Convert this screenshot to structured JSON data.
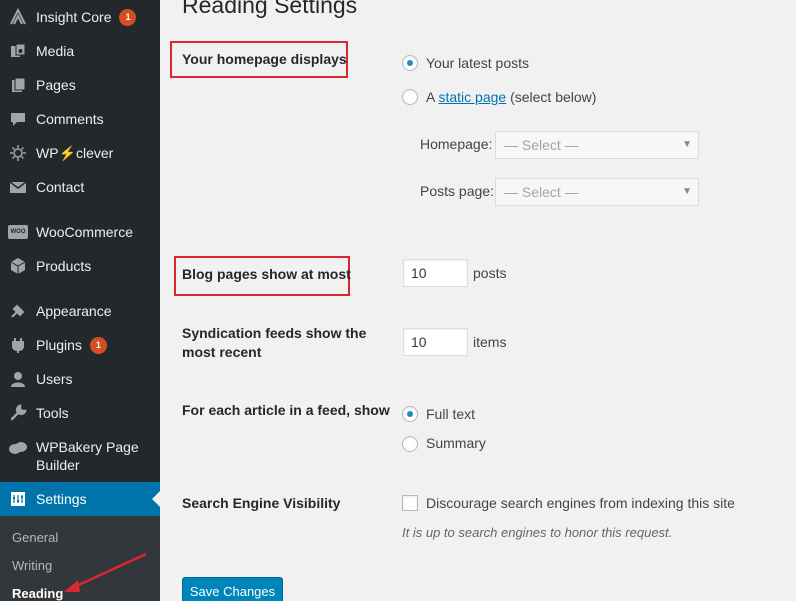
{
  "sidebar": {
    "items": [
      {
        "label": "Insight Core",
        "icon": "insight-icon",
        "badge": "1"
      },
      {
        "label": "Media",
        "icon": "media-icon"
      },
      {
        "label": "Pages",
        "icon": "pages-icon"
      },
      {
        "label": "Comments",
        "icon": "comments-icon"
      },
      {
        "label": "WP⚡clever",
        "icon": "wpclever-icon"
      },
      {
        "label": "Contact",
        "icon": "contact-icon"
      },
      {
        "label": "WooCommerce",
        "icon": "woocommerce-icon",
        "icon_text": "WOO"
      },
      {
        "label": "Products",
        "icon": "products-icon"
      },
      {
        "label": "Appearance",
        "icon": "appearance-icon"
      },
      {
        "label": "Plugins",
        "icon": "plugins-icon",
        "badge": "1"
      },
      {
        "label": "Users",
        "icon": "users-icon"
      },
      {
        "label": "Tools",
        "icon": "tools-icon"
      },
      {
        "label": "WPBakery Page",
        "label2": "Builder",
        "icon": "wpbakery-icon"
      },
      {
        "label": "Settings",
        "icon": "settings-icon",
        "active": true
      }
    ],
    "submenu": [
      {
        "label": "General"
      },
      {
        "label": "Writing"
      },
      {
        "label": "Reading",
        "current": true
      }
    ]
  },
  "page": {
    "title": "Reading Settings",
    "homepage_displays": {
      "label": "Your homepage displays",
      "option_latest": "Your latest posts",
      "option_static_prefix": "A",
      "option_static_link": "static page",
      "option_static_suffix": "(select below)",
      "selected": "latest",
      "homepage_label": "Homepage:",
      "homepage_value": "— Select —",
      "posts_page_label": "Posts page:",
      "posts_page_value": "— Select —"
    },
    "blog_pages": {
      "label": "Blog pages show at most",
      "value": "10",
      "unit": "posts"
    },
    "syndication": {
      "label_line1": "Syndication feeds show the",
      "label_line2": "most recent",
      "value": "10",
      "unit": "items"
    },
    "feed_article": {
      "label": "For each article in a feed, show",
      "option_full": "Full text",
      "option_summary": "Summary",
      "selected": "full"
    },
    "search_visibility": {
      "label": "Search Engine Visibility",
      "checkbox_label": "Discourage search engines from indexing this site",
      "checked": false,
      "description": "It is up to search engines to honor this request."
    },
    "save_label": "Save Changes"
  },
  "colors": {
    "sidebar_bg": "#23282d",
    "active_bg": "#0073aa",
    "highlight": "#d9282f",
    "button": "#0085ba"
  }
}
